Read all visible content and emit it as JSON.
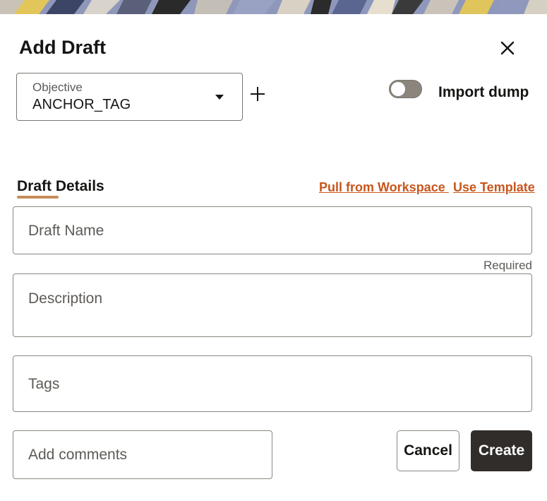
{
  "dialog": {
    "title": "Add Draft",
    "close_icon": "close-icon"
  },
  "objective": {
    "label": "Objective",
    "value": "ANCHOR_TAG",
    "caret_icon": "caret-down-icon"
  },
  "add_icon": "plus-icon",
  "import_dump": {
    "label": "Import dump",
    "enabled": false
  },
  "details": {
    "tab_label": "Draft Details",
    "pull_link": "Pull from Workspace ",
    "template_link": "Use Template"
  },
  "fields": {
    "name_placeholder": "Draft Name",
    "name_hint": "Required",
    "description_placeholder": "Description",
    "tags_placeholder": "Tags",
    "comments_placeholder": "Add comments"
  },
  "actions": {
    "cancel": "Cancel",
    "create": "Create"
  },
  "colors": {
    "accent_link": "#c7561d",
    "tab_underline": "#c78d5a",
    "primary_button": "#312d2a"
  }
}
